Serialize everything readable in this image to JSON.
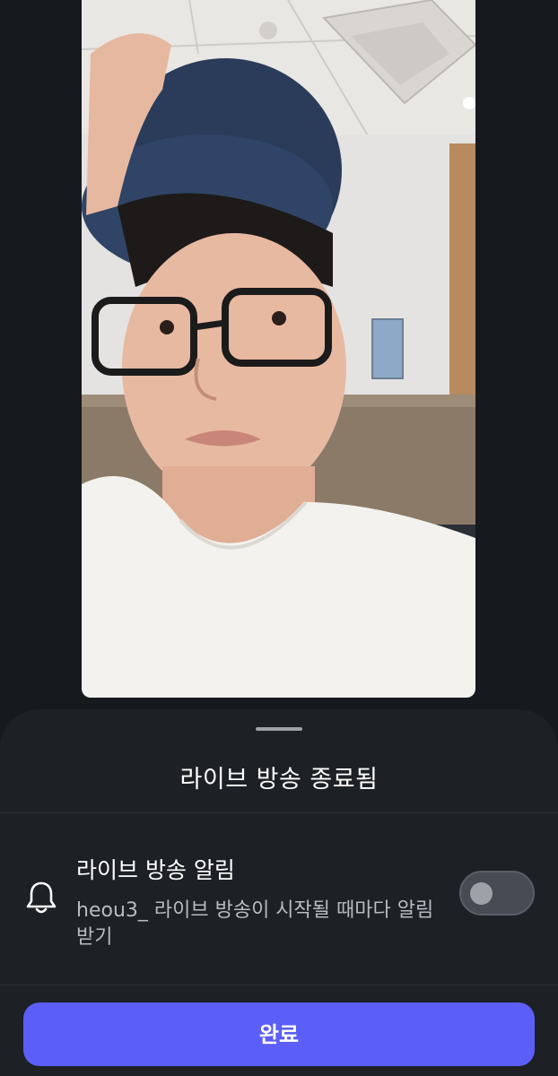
{
  "video_preview": {
    "content": "selfie-video-frame"
  },
  "sheet": {
    "title": "라이브 방송 종료됨",
    "notification": {
      "icon": "bell-icon",
      "title": "라이브 방송 알림",
      "description": "heou3_ 라이브 방송이 시작될 때마다 알림 받기",
      "toggle_on": false
    },
    "done_button_label": "완료"
  },
  "colors": {
    "background": "#16191e",
    "sheet": "#1d2025",
    "accent": "#5b5ef7",
    "toggle_off": "#474b53"
  }
}
